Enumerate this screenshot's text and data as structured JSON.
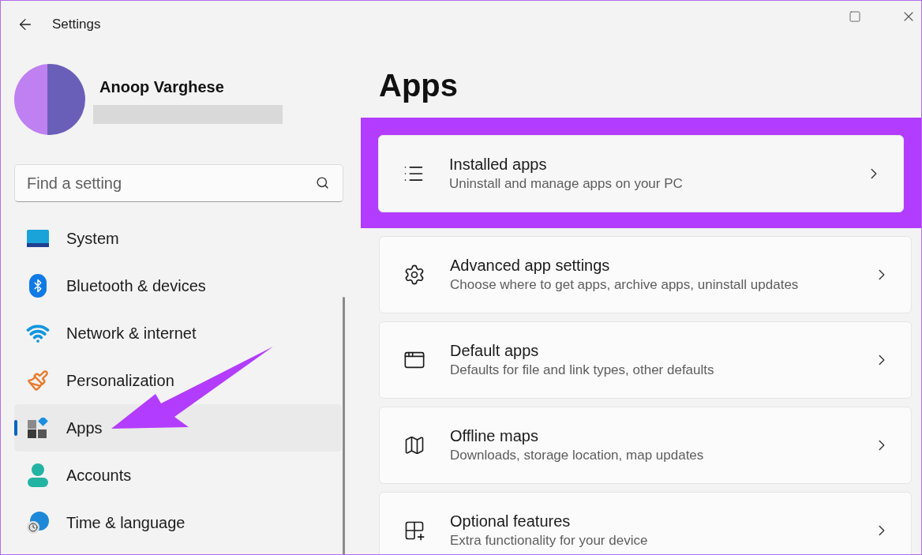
{
  "window": {
    "title": "Settings"
  },
  "profile": {
    "name": "Anoop Varghese"
  },
  "search": {
    "placeholder": "Find a setting"
  },
  "nav": [
    {
      "label": "System",
      "kind": "system",
      "selected": false
    },
    {
      "label": "Bluetooth & devices",
      "kind": "bluetooth",
      "selected": false
    },
    {
      "label": "Network & internet",
      "kind": "network",
      "selected": false
    },
    {
      "label": "Personalization",
      "kind": "personalization",
      "selected": false
    },
    {
      "label": "Apps",
      "kind": "apps",
      "selected": true
    },
    {
      "label": "Accounts",
      "kind": "accounts",
      "selected": false
    },
    {
      "label": "Time & language",
      "kind": "time",
      "selected": false
    }
  ],
  "page_title": "Apps",
  "cards": [
    {
      "title": "Installed apps",
      "subtitle": "Uninstall and manage apps on your PC",
      "kind": "installed",
      "highlighted": true
    },
    {
      "title": "Advanced app settings",
      "subtitle": "Choose where to get apps, archive apps, uninstall updates",
      "kind": "advanced",
      "highlighted": false
    },
    {
      "title": "Default apps",
      "subtitle": "Defaults for file and link types, other defaults",
      "kind": "default",
      "highlighted": false
    },
    {
      "title": "Offline maps",
      "subtitle": "Downloads, storage location, map updates",
      "kind": "maps",
      "highlighted": false
    },
    {
      "title": "Optional features",
      "subtitle": "Extra functionality for your device",
      "kind": "optional",
      "highlighted": false
    }
  ],
  "annotations": [
    {
      "kind": "arrow"
    }
  ]
}
